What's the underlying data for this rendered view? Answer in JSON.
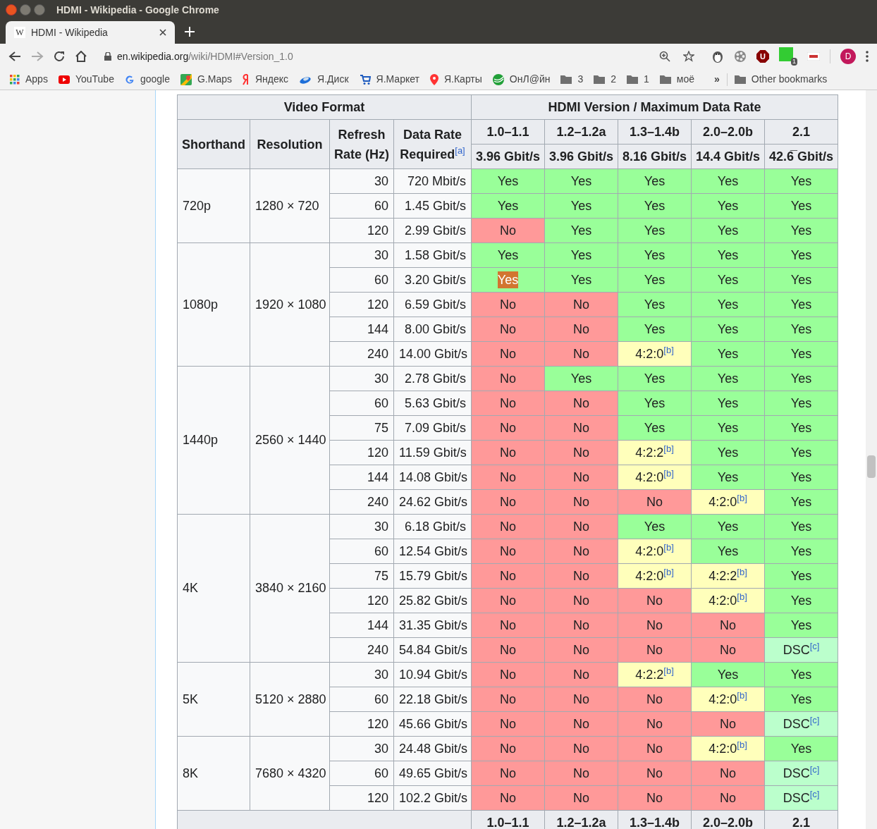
{
  "window": {
    "title": "HDMI - Wikipedia - Google Chrome"
  },
  "tabs": [
    {
      "title": "HDMI - Wikipedia",
      "favicon": "W",
      "selected": true
    }
  ],
  "address_bar": {
    "host": "en.wikipedia.org",
    "path": "/wiki/HDMI#Version_1.0"
  },
  "extensions": [
    {
      "kind": "penguin"
    },
    {
      "kind": "reel"
    },
    {
      "kind": "shield",
      "letter": "U"
    },
    {
      "kind": "green",
      "badge": "1"
    },
    {
      "kind": "clrt"
    }
  ],
  "profile": {
    "letter": "D"
  },
  "bookmarks": [
    {
      "kind": "apps",
      "label": "Apps"
    },
    {
      "kind": "youtube",
      "label": "YouTube"
    },
    {
      "kind": "google",
      "label": "google"
    },
    {
      "kind": "maps",
      "label": "G.Maps"
    },
    {
      "kind": "yandex",
      "label": "Яндекс"
    },
    {
      "kind": "disk",
      "label": "Я.Диск"
    },
    {
      "kind": "cart",
      "label": "Я.Маркет"
    },
    {
      "kind": "pin",
      "label": "Я.Карты"
    },
    {
      "kind": "sber",
      "label": "ОнЛ@йн"
    },
    {
      "kind": "folder",
      "label": "3"
    },
    {
      "kind": "folder",
      "label": "2"
    },
    {
      "kind": "folder",
      "label": "1"
    },
    {
      "kind": "folder",
      "label": "моё"
    }
  ],
  "bookmarks_overflow": "»",
  "other_bookmarks": "Other bookmarks",
  "table": {
    "group_headers": [
      "Video Format",
      "HDMI Version / Maximum Data Rate"
    ],
    "columns": [
      {
        "label": "Shorthand"
      },
      {
        "label": "Resolution"
      },
      {
        "label": "Refresh Rate (Hz)"
      },
      {
        "label": "Data Rate Required",
        "note": "[a]"
      }
    ],
    "versions": [
      {
        "label": "1.0–1.1",
        "rate": "3.96 Gbit/s"
      },
      {
        "label": "1.2–1.2a",
        "rate": "3.96 Gbit/s"
      },
      {
        "label": "1.3–1.4b",
        "rate": "8.16 Gbit/s"
      },
      {
        "label": "2.0–2.0b",
        "rate": "14.4 Gbit/s"
      },
      {
        "label": "2.1",
        "rate": "42.6̅ Gbit/s"
      }
    ],
    "groups": [
      {
        "shorthand": "720p",
        "resolution": "1280 × 720",
        "rows": [
          {
            "hz": "30",
            "rate": "720 Mbit/s",
            "cells": [
              {
                "kind": "yes",
                "text": "Yes",
                "highlighted": false
              },
              {
                "kind": "yes",
                "text": "Yes",
                "highlighted": false
              },
              {
                "kind": "yes",
                "text": "Yes",
                "highlighted": false
              },
              {
                "kind": "yes",
                "text": "Yes",
                "highlighted": false
              },
              {
                "kind": "yes",
                "text": "Yes",
                "highlighted": false
              }
            ]
          },
          {
            "hz": "60",
            "rate": "1.45 Gbit/s",
            "cells": [
              {
                "kind": "yes",
                "text": "Yes",
                "highlighted": false
              },
              {
                "kind": "yes",
                "text": "Yes",
                "highlighted": false
              },
              {
                "kind": "yes",
                "text": "Yes",
                "highlighted": false
              },
              {
                "kind": "yes",
                "text": "Yes",
                "highlighted": false
              },
              {
                "kind": "yes",
                "text": "Yes",
                "highlighted": false
              }
            ]
          },
          {
            "hz": "120",
            "rate": "2.99 Gbit/s",
            "cells": [
              {
                "kind": "no",
                "text": "No",
                "highlighted": false
              },
              {
                "kind": "yes",
                "text": "Yes",
                "highlighted": false
              },
              {
                "kind": "yes",
                "text": "Yes",
                "highlighted": false
              },
              {
                "kind": "yes",
                "text": "Yes",
                "highlighted": false
              },
              {
                "kind": "yes",
                "text": "Yes",
                "highlighted": false
              }
            ]
          }
        ]
      },
      {
        "shorthand": "1080p",
        "resolution": "1920 × 1080",
        "rows": [
          {
            "hz": "30",
            "rate": "1.58 Gbit/s",
            "cells": [
              {
                "kind": "yes",
                "text": "Yes",
                "highlighted": false
              },
              {
                "kind": "yes",
                "text": "Yes",
                "highlighted": false
              },
              {
                "kind": "yes",
                "text": "Yes",
                "highlighted": false
              },
              {
                "kind": "yes",
                "text": "Yes",
                "highlighted": false
              },
              {
                "kind": "yes",
                "text": "Yes",
                "highlighted": false
              }
            ]
          },
          {
            "hz": "60",
            "rate": "3.20 Gbit/s",
            "cells": [
              {
                "kind": "yes",
                "text": "Yes",
                "highlighted": true
              },
              {
                "kind": "yes",
                "text": "Yes",
                "highlighted": false
              },
              {
                "kind": "yes",
                "text": "Yes",
                "highlighted": false
              },
              {
                "kind": "yes",
                "text": "Yes",
                "highlighted": false
              },
              {
                "kind": "yes",
                "text": "Yes",
                "highlighted": false
              }
            ]
          },
          {
            "hz": "120",
            "rate": "6.59 Gbit/s",
            "cells": [
              {
                "kind": "no",
                "text": "No",
                "highlighted": false
              },
              {
                "kind": "no",
                "text": "No",
                "highlighted": false
              },
              {
                "kind": "yes",
                "text": "Yes",
                "highlighted": false
              },
              {
                "kind": "yes",
                "text": "Yes",
                "highlighted": false
              },
              {
                "kind": "yes",
                "text": "Yes",
                "highlighted": false
              }
            ]
          },
          {
            "hz": "144",
            "rate": "8.00 Gbit/s",
            "cells": [
              {
                "kind": "no",
                "text": "No",
                "highlighted": false
              },
              {
                "kind": "no",
                "text": "No",
                "highlighted": false
              },
              {
                "kind": "yes",
                "text": "Yes",
                "highlighted": false
              },
              {
                "kind": "yes",
                "text": "Yes",
                "highlighted": false
              },
              {
                "kind": "yes",
                "text": "Yes",
                "highlighted": false
              }
            ]
          },
          {
            "hz": "240",
            "rate": "14.00 Gbit/s",
            "cells": [
              {
                "kind": "no",
                "text": "No",
                "highlighted": false
              },
              {
                "kind": "no",
                "text": "No",
                "highlighted": false
              },
              {
                "kind": "partial",
                "text": "4:2:0",
                "note": "[b]",
                "highlighted": false
              },
              {
                "kind": "yes",
                "text": "Yes",
                "highlighted": false
              },
              {
                "kind": "yes",
                "text": "Yes",
                "highlighted": false
              }
            ]
          }
        ]
      },
      {
        "shorthand": "1440p",
        "resolution": "2560 × 1440",
        "rows": [
          {
            "hz": "30",
            "rate": "2.78 Gbit/s",
            "cells": [
              {
                "kind": "no",
                "text": "No",
                "highlighted": false
              },
              {
                "kind": "yes",
                "text": "Yes",
                "highlighted": false
              },
              {
                "kind": "yes",
                "text": "Yes",
                "highlighted": false
              },
              {
                "kind": "yes",
                "text": "Yes",
                "highlighted": false
              },
              {
                "kind": "yes",
                "text": "Yes",
                "highlighted": false
              }
            ]
          },
          {
            "hz": "60",
            "rate": "5.63 Gbit/s",
            "cells": [
              {
                "kind": "no",
                "text": "No",
                "highlighted": false
              },
              {
                "kind": "no",
                "text": "No",
                "highlighted": false
              },
              {
                "kind": "yes",
                "text": "Yes",
                "highlighted": false
              },
              {
                "kind": "yes",
                "text": "Yes",
                "highlighted": false
              },
              {
                "kind": "yes",
                "text": "Yes",
                "highlighted": false
              }
            ]
          },
          {
            "hz": "75",
            "rate": "7.09 Gbit/s",
            "cells": [
              {
                "kind": "no",
                "text": "No",
                "highlighted": false
              },
              {
                "kind": "no",
                "text": "No",
                "highlighted": false
              },
              {
                "kind": "yes",
                "text": "Yes",
                "highlighted": false
              },
              {
                "kind": "yes",
                "text": "Yes",
                "highlighted": false
              },
              {
                "kind": "yes",
                "text": "Yes",
                "highlighted": false
              }
            ]
          },
          {
            "hz": "120",
            "rate": "11.59 Gbit/s",
            "cells": [
              {
                "kind": "no",
                "text": "No",
                "highlighted": false
              },
              {
                "kind": "no",
                "text": "No",
                "highlighted": false
              },
              {
                "kind": "partial",
                "text": "4:2:2",
                "note": "[b]",
                "highlighted": false
              },
              {
                "kind": "yes",
                "text": "Yes",
                "highlighted": false
              },
              {
                "kind": "yes",
                "text": "Yes",
                "highlighted": false
              }
            ]
          },
          {
            "hz": "144",
            "rate": "14.08 Gbit/s",
            "cells": [
              {
                "kind": "no",
                "text": "No",
                "highlighted": false
              },
              {
                "kind": "no",
                "text": "No",
                "highlighted": false
              },
              {
                "kind": "partial",
                "text": "4:2:0",
                "note": "[b]",
                "highlighted": false
              },
              {
                "kind": "yes",
                "text": "Yes",
                "highlighted": false
              },
              {
                "kind": "yes",
                "text": "Yes",
                "highlighted": false
              }
            ]
          },
          {
            "hz": "240",
            "rate": "24.62 Gbit/s",
            "cells": [
              {
                "kind": "no",
                "text": "No",
                "highlighted": false
              },
              {
                "kind": "no",
                "text": "No",
                "highlighted": false
              },
              {
                "kind": "no",
                "text": "No",
                "highlighted": false
              },
              {
                "kind": "partial",
                "text": "4:2:0",
                "note": "[b]",
                "highlighted": false
              },
              {
                "kind": "yes",
                "text": "Yes",
                "highlighted": false
              }
            ]
          }
        ]
      },
      {
        "shorthand": "4K",
        "resolution": "3840 × 2160",
        "rows": [
          {
            "hz": "30",
            "rate": "6.18 Gbit/s",
            "cells": [
              {
                "kind": "no",
                "text": "No",
                "highlighted": false
              },
              {
                "kind": "no",
                "text": "No",
                "highlighted": false
              },
              {
                "kind": "yes",
                "text": "Yes",
                "highlighted": false
              },
              {
                "kind": "yes",
                "text": "Yes",
                "highlighted": false
              },
              {
                "kind": "yes",
                "text": "Yes",
                "highlighted": false
              }
            ]
          },
          {
            "hz": "60",
            "rate": "12.54 Gbit/s",
            "cells": [
              {
                "kind": "no",
                "text": "No",
                "highlighted": false
              },
              {
                "kind": "no",
                "text": "No",
                "highlighted": false
              },
              {
                "kind": "partial",
                "text": "4:2:0",
                "note": "[b]",
                "highlighted": false
              },
              {
                "kind": "yes",
                "text": "Yes",
                "highlighted": false
              },
              {
                "kind": "yes",
                "text": "Yes",
                "highlighted": false
              }
            ]
          },
          {
            "hz": "75",
            "rate": "15.79 Gbit/s",
            "cells": [
              {
                "kind": "no",
                "text": "No",
                "highlighted": false
              },
              {
                "kind": "no",
                "text": "No",
                "highlighted": false
              },
              {
                "kind": "partial",
                "text": "4:2:0",
                "note": "[b]",
                "highlighted": false
              },
              {
                "kind": "partial",
                "text": "4:2:2",
                "note": "[b]",
                "highlighted": false
              },
              {
                "kind": "yes",
                "text": "Yes",
                "highlighted": false
              }
            ]
          },
          {
            "hz": "120",
            "rate": "25.82 Gbit/s",
            "cells": [
              {
                "kind": "no",
                "text": "No",
                "highlighted": false
              },
              {
                "kind": "no",
                "text": "No",
                "highlighted": false
              },
              {
                "kind": "no",
                "text": "No",
                "highlighted": false
              },
              {
                "kind": "partial",
                "text": "4:2:0",
                "note": "[b]",
                "highlighted": false
              },
              {
                "kind": "yes",
                "text": "Yes",
                "highlighted": false
              }
            ]
          },
          {
            "hz": "144",
            "rate": "31.35 Gbit/s",
            "cells": [
              {
                "kind": "no",
                "text": "No",
                "highlighted": false
              },
              {
                "kind": "no",
                "text": "No",
                "highlighted": false
              },
              {
                "kind": "no",
                "text": "No",
                "highlighted": false
              },
              {
                "kind": "no",
                "text": "No",
                "highlighted": false
              },
              {
                "kind": "yes",
                "text": "Yes",
                "highlighted": false
              }
            ]
          },
          {
            "hz": "240",
            "rate": "54.84 Gbit/s",
            "cells": [
              {
                "kind": "no",
                "text": "No",
                "highlighted": false
              },
              {
                "kind": "no",
                "text": "No",
                "highlighted": false
              },
              {
                "kind": "no",
                "text": "No",
                "highlighted": false
              },
              {
                "kind": "no",
                "text": "No",
                "highlighted": false
              },
              {
                "kind": "dsc",
                "text": "DSC",
                "note": "[c]",
                "highlighted": false
              }
            ]
          }
        ]
      },
      {
        "shorthand": "5K",
        "resolution": "5120 × 2880",
        "rows": [
          {
            "hz": "30",
            "rate": "10.94 Gbit/s",
            "cells": [
              {
                "kind": "no",
                "text": "No",
                "highlighted": false
              },
              {
                "kind": "no",
                "text": "No",
                "highlighted": false
              },
              {
                "kind": "partial",
                "text": "4:2:2",
                "note": "[b]",
                "highlighted": false
              },
              {
                "kind": "yes",
                "text": "Yes",
                "highlighted": false
              },
              {
                "kind": "yes",
                "text": "Yes",
                "highlighted": false
              }
            ]
          },
          {
            "hz": "60",
            "rate": "22.18 Gbit/s",
            "cells": [
              {
                "kind": "no",
                "text": "No",
                "highlighted": false
              },
              {
                "kind": "no",
                "text": "No",
                "highlighted": false
              },
              {
                "kind": "no",
                "text": "No",
                "highlighted": false
              },
              {
                "kind": "partial",
                "text": "4:2:0",
                "note": "[b]",
                "highlighted": false
              },
              {
                "kind": "yes",
                "text": "Yes",
                "highlighted": false
              }
            ]
          },
          {
            "hz": "120",
            "rate": "45.66 Gbit/s",
            "cells": [
              {
                "kind": "no",
                "text": "No",
                "highlighted": false
              },
              {
                "kind": "no",
                "text": "No",
                "highlighted": false
              },
              {
                "kind": "no",
                "text": "No",
                "highlighted": false
              },
              {
                "kind": "no",
                "text": "No",
                "highlighted": false
              },
              {
                "kind": "dsc",
                "text": "DSC",
                "note": "[c]",
                "highlighted": false
              }
            ]
          }
        ]
      },
      {
        "shorthand": "8K",
        "resolution": "7680 × 4320",
        "rows": [
          {
            "hz": "30",
            "rate": "24.48 Gbit/s",
            "cells": [
              {
                "kind": "no",
                "text": "No",
                "highlighted": false
              },
              {
                "kind": "no",
                "text": "No",
                "highlighted": false
              },
              {
                "kind": "no",
                "text": "No",
                "highlighted": false
              },
              {
                "kind": "partial",
                "text": "4:2:0",
                "note": "[b]",
                "highlighted": false
              },
              {
                "kind": "yes",
                "text": "Yes",
                "highlighted": false
              }
            ]
          },
          {
            "hz": "60",
            "rate": "49.65 Gbit/s",
            "cells": [
              {
                "kind": "no",
                "text": "No",
                "highlighted": false
              },
              {
                "kind": "no",
                "text": "No",
                "highlighted": false
              },
              {
                "kind": "no",
                "text": "No",
                "highlighted": false
              },
              {
                "kind": "no",
                "text": "No",
                "highlighted": false
              },
              {
                "kind": "dsc",
                "text": "DSC",
                "note": "[c]",
                "highlighted": false
              }
            ]
          },
          {
            "hz": "120",
            "rate": "102.2 Gbit/s",
            "cells": [
              {
                "kind": "no",
                "text": "No",
                "highlighted": false
              },
              {
                "kind": "no",
                "text": "No",
                "highlighted": false
              },
              {
                "kind": "no",
                "text": "No",
                "highlighted": false
              },
              {
                "kind": "no",
                "text": "No",
                "highlighted": false
              },
              {
                "kind": "dsc",
                "text": "DSC",
                "note": "[c]",
                "highlighted": false
              }
            ]
          }
        ]
      }
    ],
    "footer_versions": [
      "1.0–1.1",
      "1.2–1.2a",
      "1.3–1.4b",
      "2.0–2.0b",
      "2.1"
    ]
  }
}
